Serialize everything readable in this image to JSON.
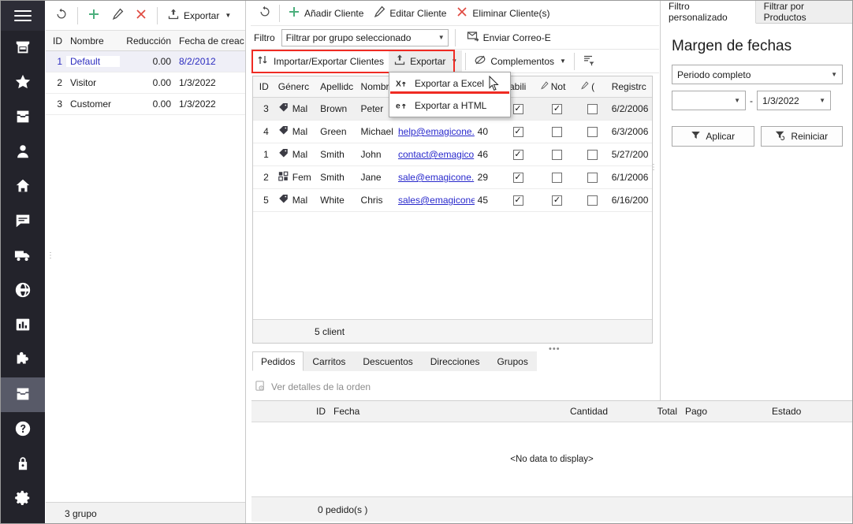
{
  "rail": {
    "menu_icon": "hamburger-icon",
    "items": [
      {
        "name": "store-icon"
      },
      {
        "name": "star-icon"
      },
      {
        "name": "inbox-icon"
      },
      {
        "name": "person-icon"
      },
      {
        "name": "home-icon"
      },
      {
        "name": "chat-icon"
      },
      {
        "name": "truck-icon"
      },
      {
        "name": "globe-icon"
      },
      {
        "name": "chart-icon"
      },
      {
        "name": "puzzle-icon"
      },
      {
        "name": "archive-icon",
        "active": true
      },
      {
        "name": "help-icon"
      },
      {
        "name": "lock-icon"
      },
      {
        "name": "gear-icon"
      }
    ]
  },
  "groups": {
    "toolbar": {
      "refresh": "refresh-icon",
      "add": "plus-icon",
      "edit": "pencil-icon",
      "delete": "close-icon",
      "export_label": "Exportar",
      "export_icon": "upload-icon"
    },
    "columns": [
      "ID",
      "Nombre",
      "Reducción",
      "Fecha de creación"
    ],
    "rows": [
      {
        "id": "1",
        "name": "Default",
        "reduction": "0.00",
        "created": "8/2/2012",
        "selected": true
      },
      {
        "id": "2",
        "name": "Visitor",
        "reduction": "0.00",
        "created": "1/3/2022",
        "selected": false
      },
      {
        "id": "3",
        "name": "Customer",
        "reduction": "0.00",
        "created": "1/3/2022",
        "selected": false
      }
    ],
    "status": "3 grupo"
  },
  "customers": {
    "toolbar_row1": {
      "refresh": "refresh-icon",
      "add_label": "Añadir Cliente",
      "edit_label": "Editar Cliente",
      "delete_label": "Eliminar Cliente(s)"
    },
    "toolbar_row2": {
      "filter_label": "Filtro",
      "filter_value": "Filtrar por grupo seleccionado",
      "email_label": "Enviar Correo-E"
    },
    "toolbar_row3": {
      "import_export_label": "Importar/Exportar Clientes",
      "export_label": "Exportar",
      "addons_label": "Complementos",
      "filter_editor_icon": "filter-editor-icon"
    },
    "columns": [
      "ID",
      "Génerc",
      "Apellidc",
      "Nombr",
      "",
      "",
      "Habili",
      "Not",
      "(",
      "Registrc"
    ],
    "rows": [
      {
        "id": "3",
        "gender": "Mal",
        "gender_icon": "tag-icon",
        "lastname": "Brown",
        "firstname": "Peter",
        "email": "",
        "age": "",
        "enabled": true,
        "notify": true,
        "other": false,
        "registered": "6/2/2006",
        "selected": true
      },
      {
        "id": "4",
        "gender": "Mal",
        "gender_icon": "tag-icon",
        "lastname": "Green",
        "firstname": "Michael",
        "email": "help@emagicone.",
        "age": "40",
        "enabled": true,
        "notify": false,
        "other": false,
        "registered": "6/3/2006",
        "selected": false
      },
      {
        "id": "1",
        "gender": "Mal",
        "gender_icon": "tag-icon",
        "lastname": "Smith",
        "firstname": "John",
        "email": "contact@emagico",
        "age": "46",
        "enabled": true,
        "notify": false,
        "other": false,
        "registered": "5/27/200",
        "selected": false
      },
      {
        "id": "2",
        "gender": "Fem",
        "gender_icon": "squares-icon",
        "lastname": "Smith",
        "firstname": "Jane",
        "email": "sale@emagicone.",
        "age": "29",
        "enabled": true,
        "notify": false,
        "other": false,
        "registered": "6/1/2006",
        "selected": false
      },
      {
        "id": "5",
        "gender": "Mal",
        "gender_icon": "tag-icon",
        "lastname": "White",
        "firstname": "Chris",
        "email": "sales@emagicone",
        "age": "45",
        "enabled": true,
        "notify": true,
        "other": false,
        "registered": "6/16/200",
        "selected": false
      }
    ],
    "status": "5 client"
  },
  "export_menu": {
    "items": [
      {
        "label": "Exportar a Excel",
        "icon": "excel-export-icon",
        "highlighted": true
      },
      {
        "label": "Exportar a HTML",
        "icon": "html-export-icon",
        "highlighted": false
      }
    ]
  },
  "bottom": {
    "tabs": [
      {
        "label": "Pedidos",
        "active": true
      },
      {
        "label": "Carritos",
        "active": false
      },
      {
        "label": "Descuentos",
        "active": false
      },
      {
        "label": "Direcciones",
        "active": false
      },
      {
        "label": "Grupos",
        "active": false
      }
    ],
    "action_label": "Ver detalles de la orden",
    "action_icon": "view-order-icon",
    "columns": [
      "ID",
      "Fecha",
      "Cantidad",
      "Total",
      "Pago",
      "Estado"
    ],
    "empty_message": "<No data to display>",
    "status": "0 pedido(s )"
  },
  "right_panel": {
    "tabs": [
      {
        "label": "Filtro personalizado",
        "active": true
      },
      {
        "label": "Filtrar por Productos",
        "active": false
      }
    ],
    "title": "Margen de fechas",
    "period_value": "Periodo completo",
    "date_from": "",
    "date_separator": "-",
    "date_to": "1/3/2022",
    "apply_label": "Aplicar",
    "apply_icon": "funnel-icon",
    "reset_label": "Reiniciar",
    "reset_icon": "funnel-reset-icon"
  },
  "colors": {
    "rail_bg": "#23232b",
    "rail_active": "#585a68",
    "highlight_red": "#ef2b23",
    "link_blue": "#2929cc",
    "accent_green": "#4caf7d"
  }
}
